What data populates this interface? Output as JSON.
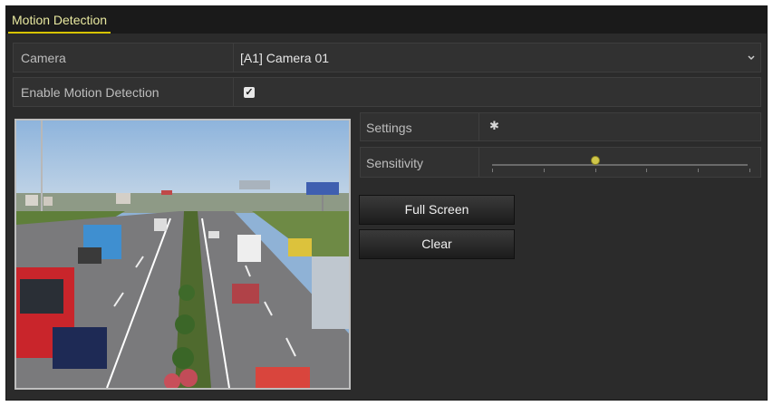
{
  "tab": {
    "label": "Motion Detection"
  },
  "camera": {
    "label": "Camera",
    "value": "[A1] Camera 01"
  },
  "enable": {
    "label": "Enable Motion Detection",
    "checked": true
  },
  "settings": {
    "label": "Settings"
  },
  "sensitivity": {
    "label": "Sensitivity",
    "level": 0.4,
    "ticks": 6
  },
  "buttons": {
    "full_screen": "Full Screen",
    "clear": "Clear"
  },
  "colors": {
    "accent": "#d6c300",
    "background": "#2b2b2b",
    "row": "#313131"
  },
  "icons": {
    "dropdown": "chevron-down-icon",
    "checkbox": "check-icon",
    "settings": "gear-icon"
  }
}
